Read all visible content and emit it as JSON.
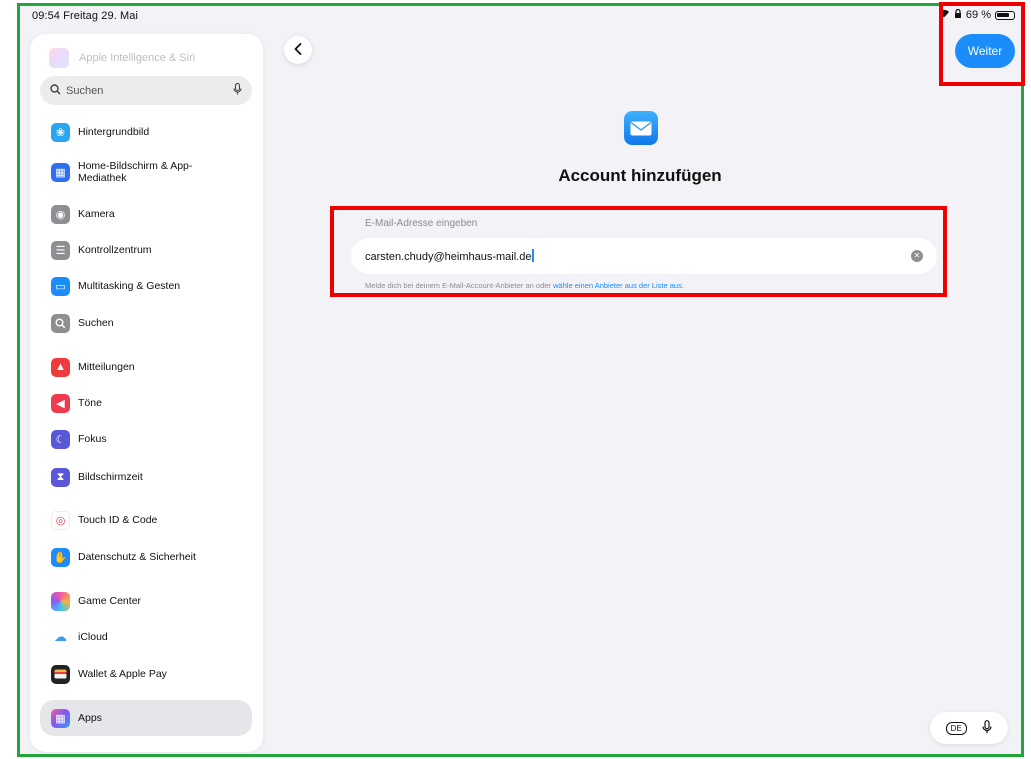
{
  "status_bar": {
    "time_date": "09:54 Freitag 29. Mai",
    "battery_text": "69 %"
  },
  "sidebar": {
    "top_item_label": "Apple Intelligence & Siri",
    "search_placeholder": "Suchen",
    "items": [
      {
        "label": "Hintergrundbild",
        "icon": "flower-icon",
        "color": "#2aa5f0"
      },
      {
        "label": "Home-Bildschirm & App-Mediathek",
        "icon": "home-screen-icon",
        "color": "#2f6ff2"
      },
      {
        "label": "Kamera",
        "icon": "camera-icon",
        "color": "#8e8e93"
      },
      {
        "label": "Kontrollzentrum",
        "icon": "toggles-icon",
        "color": "#8e8e93"
      },
      {
        "label": "Multitasking & Gesten",
        "icon": "multitasking-icon",
        "color": "#1a8dfb"
      },
      {
        "label": "Suchen",
        "icon": "search-icon",
        "color": "#8e8e93"
      },
      {
        "label": "Mitteilungen",
        "icon": "bell-icon",
        "color": "#ee3b3b"
      },
      {
        "label": "Töne",
        "icon": "speaker-icon",
        "color": "#ee3b4f"
      },
      {
        "label": "Fokus",
        "icon": "moon-icon",
        "color": "#5b57d9"
      },
      {
        "label": "Bildschirmzeit",
        "icon": "hourglass-icon",
        "color": "#5b57d9"
      },
      {
        "label": "Touch ID & Code",
        "icon": "fingerprint-icon",
        "color": "#ee3b4f"
      },
      {
        "label": "Datenschutz & Sicherheit",
        "icon": "hand-icon",
        "color": "#1a8dfb"
      },
      {
        "label": "Game Center",
        "icon": "game-center-icon",
        "color": "#f15aa6"
      },
      {
        "label": "iCloud",
        "icon": "cloud-icon",
        "color": "#3b9cf5"
      },
      {
        "label": "Wallet & Apple Pay",
        "icon": "wallet-icon",
        "color": "#222222"
      },
      {
        "label": "Apps",
        "icon": "apps-grid-icon",
        "color": "#7a5cf0"
      }
    ]
  },
  "main": {
    "back_label": "‹",
    "next_button": "Weiter",
    "title": "Account hinzufügen",
    "field_label": "E-Mail-Adresse eingeben",
    "email_value": "carsten.chudy@heimhaus-mail.de",
    "hint_text": "Melde dich bei deinem E-Mail-Account-Anbieter an oder ",
    "hint_link": "wähle einen Anbieter aus der Liste aus.",
    "keyboard_language": "DE"
  },
  "colors": {
    "accent": "#1a8dfb",
    "annotation_red": "#ee0000",
    "annotation_green": "#22a63a"
  }
}
